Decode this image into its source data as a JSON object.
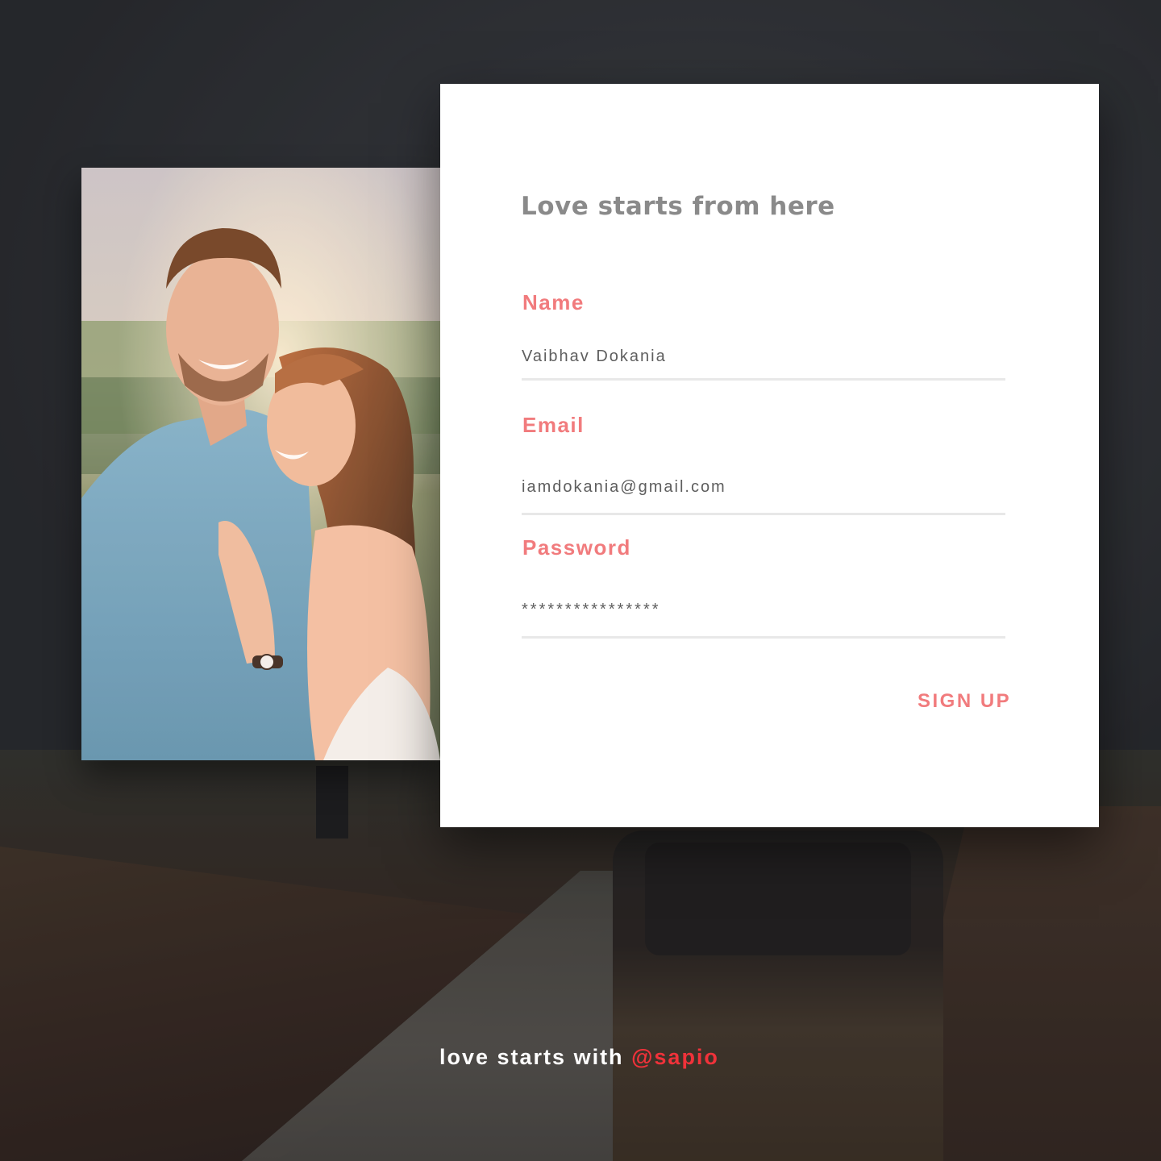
{
  "form": {
    "title": "Love starts from here",
    "name": {
      "label": "Name",
      "value": "Vaibhav Dokania"
    },
    "email": {
      "label": "Email",
      "value": "iamdokania@gmail.com"
    },
    "password": {
      "label": "Password",
      "value": "****************"
    },
    "signup_label": "SIGN UP"
  },
  "footer": {
    "tagline_text": "love starts with",
    "handle": "@sapio"
  },
  "colors": {
    "accent": "#f17b7d",
    "handle": "#f0323a",
    "title": "#8a8a8a",
    "card_bg": "#ffffff"
  },
  "icons": {
    "photo": "couple-photo"
  }
}
